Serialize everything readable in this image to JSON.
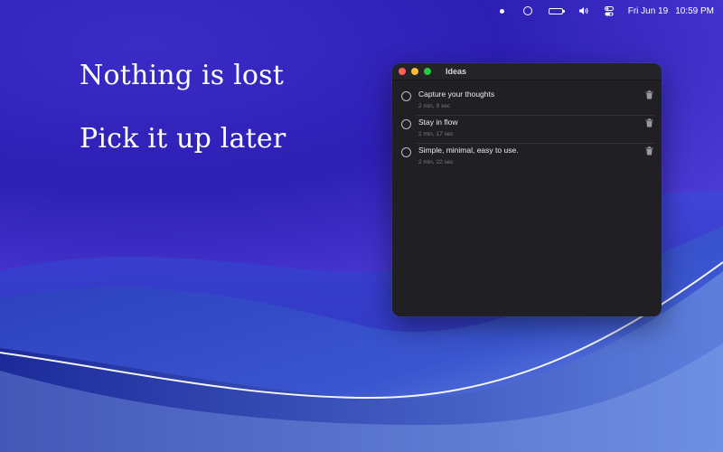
{
  "menubar": {
    "icons": [
      "dot-icon",
      "activity-ring-icon",
      "battery-icon",
      "volume-icon",
      "control-center-icon"
    ],
    "battery_level": 0.9,
    "date": "Fri Jun 19",
    "time": "10:59 PM"
  },
  "hero": {
    "line1": "Nothing is lost",
    "line2": "Pick it up later"
  },
  "window": {
    "title": "Ideas",
    "traffic_colors": {
      "close": "#ff5f57",
      "minimize": "#febc2e",
      "maximize": "#28c840"
    },
    "items": [
      {
        "title": "Capture your thoughts",
        "time": "2 min, 9 sec"
      },
      {
        "title": "Stay in flow",
        "time": "2 min, 17 sec"
      },
      {
        "title": "Simple, minimal, easy to use.",
        "time": "2 min, 22 sec"
      }
    ]
  }
}
